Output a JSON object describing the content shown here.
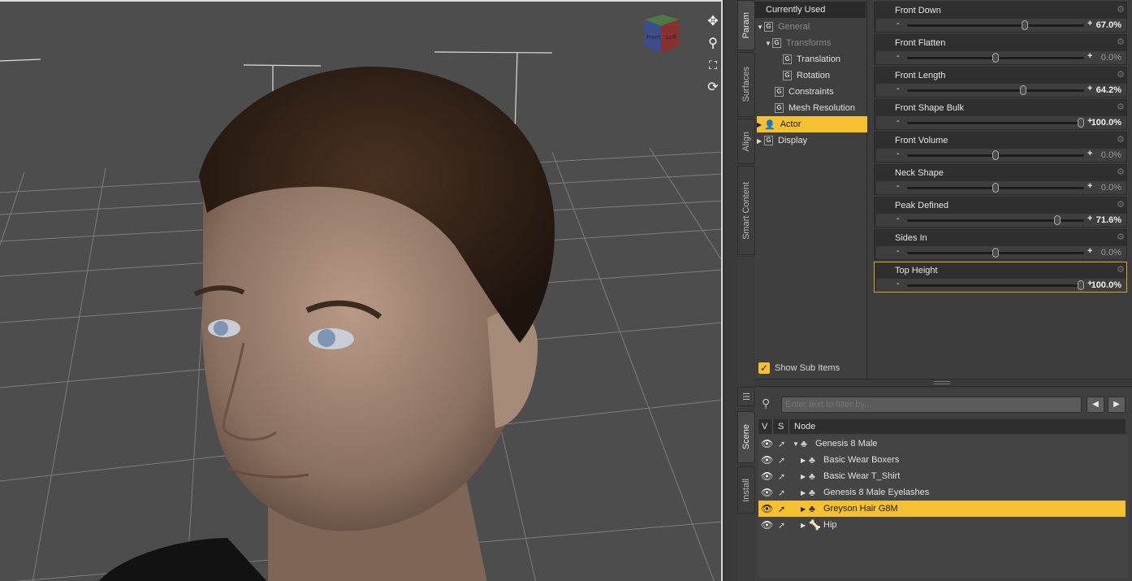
{
  "tabs": [
    {
      "label": "Parameters",
      "shown": "Param",
      "active": true
    },
    {
      "label": "Surfaces"
    },
    {
      "label": "Align"
    },
    {
      "label": "Smart Content"
    }
  ],
  "scene_tabs": [
    {
      "label": "Scene",
      "active": true
    },
    {
      "label": "Install"
    }
  ],
  "tree": {
    "header": "Currently Used",
    "items": [
      {
        "label": "General",
        "dim": true
      },
      {
        "label": "Transforms",
        "dim": true
      },
      {
        "label": "Translation"
      },
      {
        "label": "Rotation"
      },
      {
        "label": "Constraints"
      },
      {
        "label": "Mesh Resolution"
      },
      {
        "label": "Actor",
        "selected": true
      },
      {
        "label": "Display"
      }
    ],
    "show_sub_items": "Show Sub Items"
  },
  "sliders": [
    {
      "label": "Front Down",
      "value": "67.0%",
      "fraction": 0.67
    },
    {
      "label": "Front Flatten",
      "value": "0.0%",
      "fraction": 0.5
    },
    {
      "label": "Front Length",
      "value": "64.2%",
      "fraction": 0.66
    },
    {
      "label": "Front Shape Bulk",
      "value": "100.0%",
      "fraction": 1.0
    },
    {
      "label": "Front Volume",
      "value": "0.0%",
      "fraction": 0.5
    },
    {
      "label": "Neck Shape",
      "value": "0.0%",
      "fraction": 0.5
    },
    {
      "label": "Peak Defined",
      "value": "71.6%",
      "fraction": 0.86
    },
    {
      "label": "Sides In",
      "value": "0.0%",
      "fraction": 0.5
    },
    {
      "label": "Top Height",
      "value": "100.0%",
      "fraction": 1.0,
      "selected": true
    }
  ],
  "slider_symbols": {
    "minus": "-",
    "plus": "+"
  },
  "scene": {
    "filter_placeholder": "Enter text to filter by...",
    "columns": {
      "v": "V",
      "s": "S",
      "node": "Node"
    },
    "nodes": [
      {
        "name": "Genesis 8 Male",
        "expanded": true,
        "icon": "figure-icon"
      },
      {
        "name": "Basic Wear Boxers",
        "icon": "figure-icon"
      },
      {
        "name": "Basic Wear T_Shirt",
        "icon": "figure-icon"
      },
      {
        "name": "Genesis 8 Male Eyelashes",
        "icon": "figure-icon"
      },
      {
        "name": "Greyson Hair G8M",
        "selected": true,
        "icon": "figure-icon"
      },
      {
        "name": "Hip",
        "icon": "bone-icon"
      }
    ]
  },
  "colors": {
    "accent": "#f6c130",
    "panel": "#3f3f3f",
    "viewport": "#4d4d4d"
  }
}
